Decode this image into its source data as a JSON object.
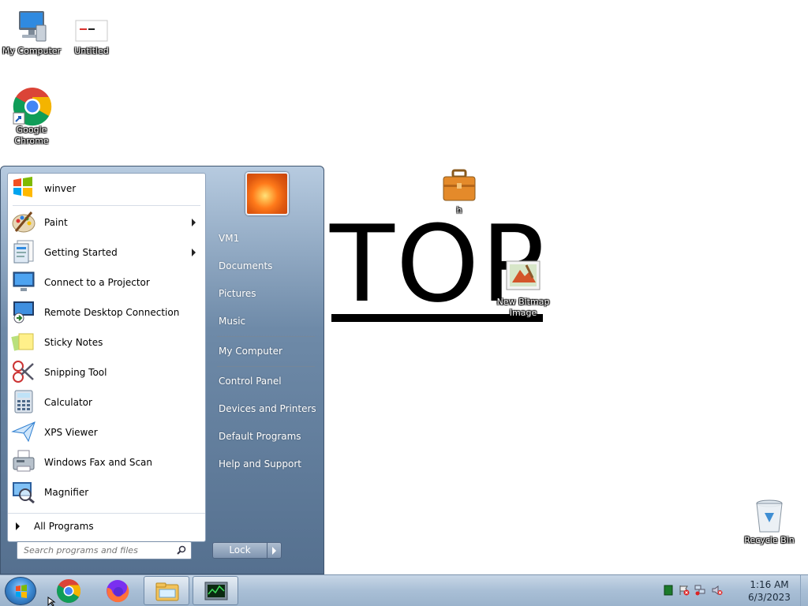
{
  "desktop": {
    "icons": {
      "my_computer": "My Computer",
      "untitled": "Untitled",
      "untitled_thumb_text": "CRYPAL TOP",
      "google_chrome_line1": "Google",
      "google_chrome_line2": "Chrome",
      "briefcase": "h",
      "new_bitmap_line1": "New Bitmap",
      "new_bitmap_line2": "Image",
      "recycle_bin": "Recycle Bin"
    },
    "wallpaper_text": "TOP"
  },
  "start_menu": {
    "programs": [
      {
        "label": "winver",
        "icon": "windows-flag-icon",
        "submenu": false
      },
      {
        "label": "Paint",
        "icon": "paint-palette-icon",
        "submenu": true
      },
      {
        "label": "Getting Started",
        "icon": "getting-started-icon",
        "submenu": true
      },
      {
        "label": "Connect to a Projector",
        "icon": "projector-icon",
        "submenu": false
      },
      {
        "label": "Remote Desktop Connection",
        "icon": "remote-desktop-icon",
        "submenu": false
      },
      {
        "label": "Sticky Notes",
        "icon": "sticky-notes-icon",
        "submenu": false
      },
      {
        "label": "Snipping Tool",
        "icon": "scissors-icon",
        "submenu": false
      },
      {
        "label": "Calculator",
        "icon": "calculator-icon",
        "submenu": false
      },
      {
        "label": "XPS Viewer",
        "icon": "paper-plane-icon",
        "submenu": false
      },
      {
        "label": "Windows Fax and Scan",
        "icon": "fax-icon",
        "submenu": false
      },
      {
        "label": "Magnifier",
        "icon": "magnifier-icon",
        "submenu": false
      }
    ],
    "all_programs": "All Programs",
    "search_placeholder": "Search programs and files",
    "right_items": {
      "user": "VM1",
      "documents": "Documents",
      "pictures": "Pictures",
      "music": "Music",
      "computer": "My Computer",
      "control_panel": "Control Panel",
      "devices": "Devices and Printers",
      "defaults": "Default Programs",
      "help": "Help and Support"
    },
    "lock_label": "Lock"
  },
  "taskbar": {
    "pinned": [
      "google-chrome-icon",
      "firefox-icon",
      "file-explorer-icon",
      "task-manager-icon"
    ],
    "clock": {
      "time": "1:16 AM",
      "date": "6/3/2023"
    }
  }
}
